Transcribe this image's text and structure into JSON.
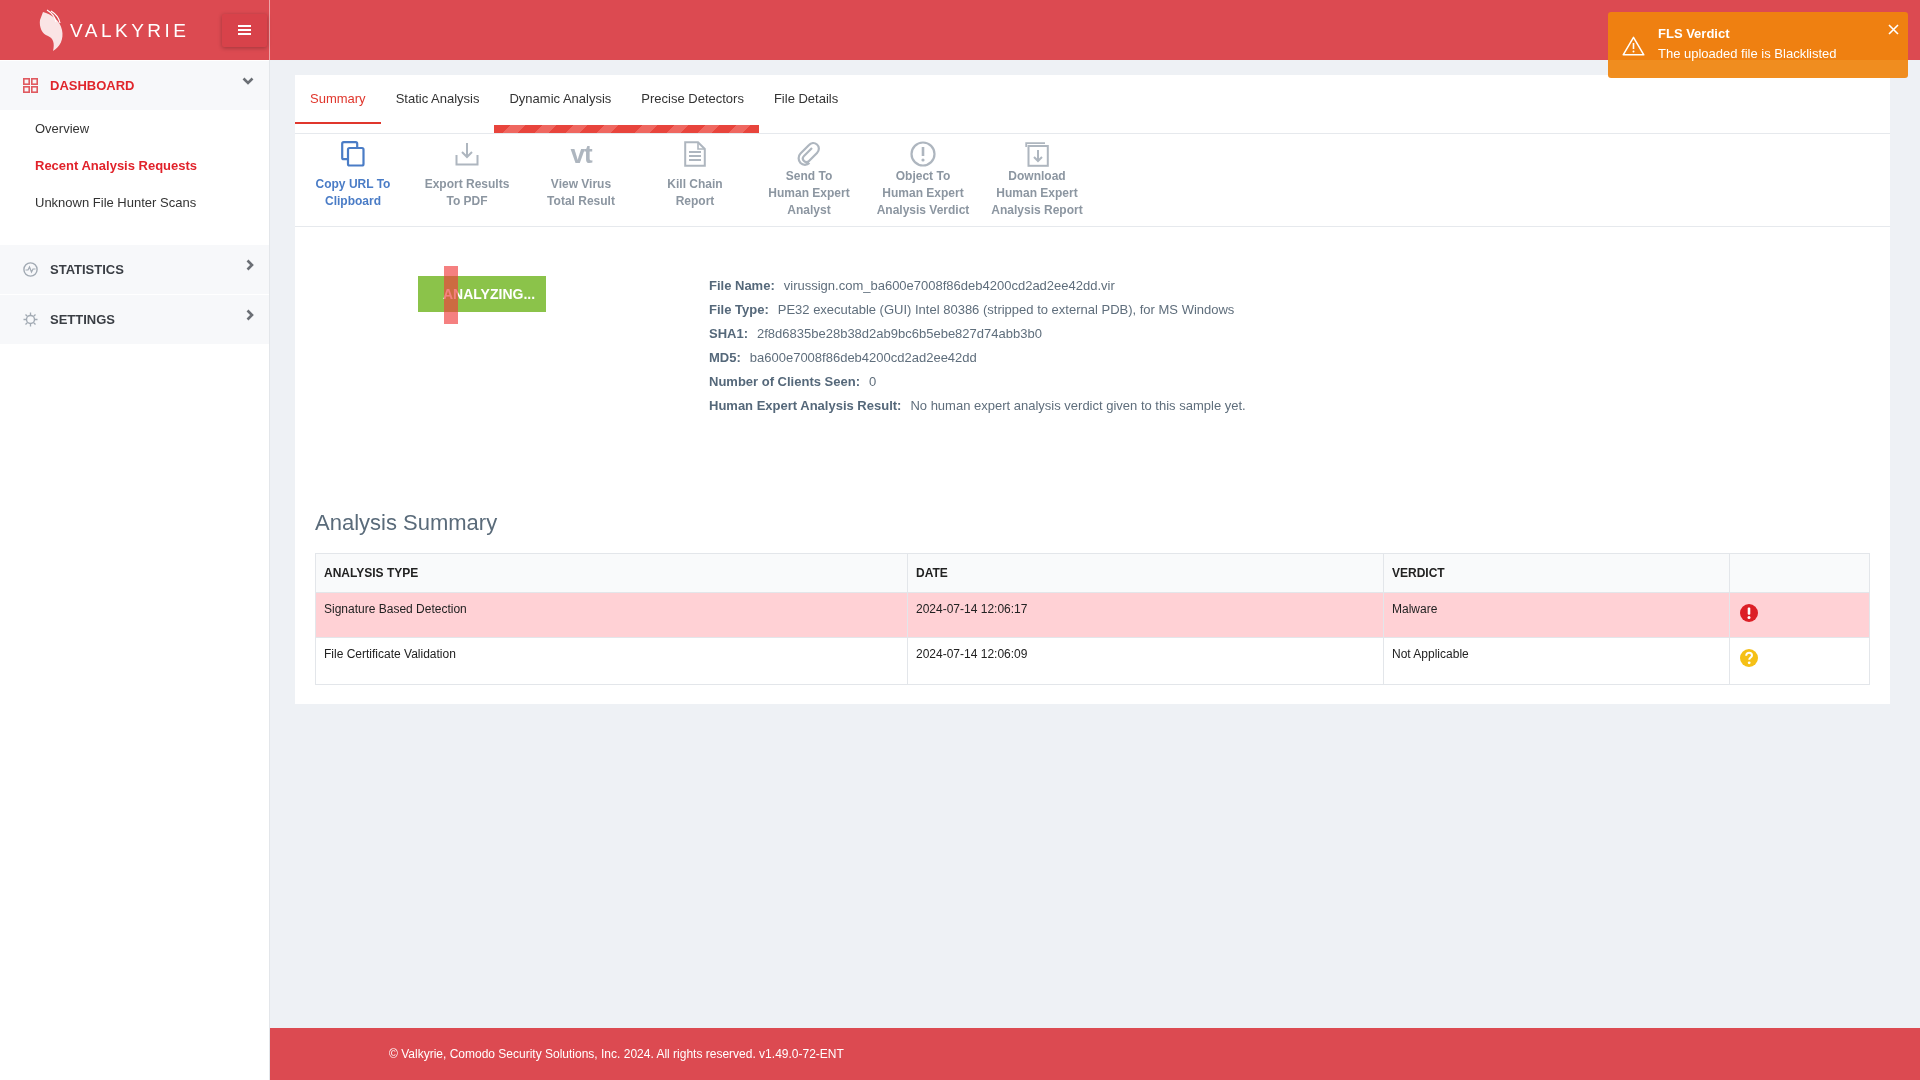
{
  "header": {
    "brand": "VALKYRIE"
  },
  "notification": {
    "title": "FLS Verdict",
    "message": "The uploaded file is Blacklisted"
  },
  "sidebar": {
    "sections": [
      {
        "label": "DASHBOARD",
        "selected": true,
        "expanded": true,
        "children": [
          {
            "label": "Overview",
            "selected": false
          },
          {
            "label": "Recent Analysis Requests",
            "selected": true
          },
          {
            "label": "Unknown File Hunter Scans",
            "selected": false
          }
        ]
      },
      {
        "label": "STATISTICS",
        "selected": false,
        "expanded": false
      },
      {
        "label": "SETTINGS",
        "selected": false,
        "expanded": false
      }
    ]
  },
  "tabs": [
    {
      "label": "Summary",
      "selected": true,
      "in_progress": false
    },
    {
      "label": "Static Analysis",
      "selected": false,
      "in_progress": false
    },
    {
      "label": "Dynamic Analysis",
      "selected": false,
      "in_progress": true
    },
    {
      "label": "Precise Detectors",
      "selected": false,
      "in_progress": true
    },
    {
      "label": "File Details",
      "selected": false,
      "in_progress": false
    }
  ],
  "toolbar": [
    {
      "label": "Copy URL To\nClipboard",
      "disabled": false
    },
    {
      "label": "Export Results\nTo PDF",
      "disabled": true
    },
    {
      "glyph": "vt",
      "label": "View Virus\nTotal Result",
      "disabled": true
    },
    {
      "label": "Kill Chain\nReport",
      "disabled": true
    },
    {
      "label": "Send To\nHuman Expert\nAnalyst",
      "disabled": true
    },
    {
      "label": "Object To\nHuman Expert\nAnalysis Verdict",
      "disabled": true
    },
    {
      "label": "Download\nHuman Expert\nAnalysis Report",
      "disabled": true
    }
  ],
  "status_badge": "ANALYZING...",
  "file_info": [
    {
      "label": "File Name:",
      "value": "virussign.com_ba600e7008f86deb4200cd2ad2ee42dd.vir"
    },
    {
      "label": "File Type:",
      "value": "PE32 executable (GUI) Intel 80386 (stripped to external PDB), for MS Windows"
    },
    {
      "label": "SHA1:",
      "value": "2f8d6835be28b38d2ab9bc6b5ebe827d74abb3b0"
    },
    {
      "label": "MD5:",
      "value": "ba600e7008f86deb4200cd2ad2ee42dd"
    },
    {
      "label": "Number of Clients Seen:",
      "value": "0"
    },
    {
      "label": "Human Expert Analysis Result:",
      "value": "No human expert analysis verdict given to this sample yet."
    }
  ],
  "analysis_summary": {
    "title": "Analysis Summary",
    "columns": [
      "ANALYSIS TYPE",
      "DATE",
      "VERDICT"
    ],
    "rows": [
      {
        "kind": "danger",
        "cells": [
          "Signature Based Detection",
          "2024-07-14 12:06:17",
          "Malware"
        ]
      },
      {
        "kind": "unknown",
        "cells": [
          "File Certificate Validation",
          "2024-07-14 12:06:09",
          "Not Applicable"
        ]
      }
    ]
  },
  "footer": "© Valkyrie, Comodo Security Solutions, Inc. 2024. All rights reserved. v1.49.0-72-ENT"
}
